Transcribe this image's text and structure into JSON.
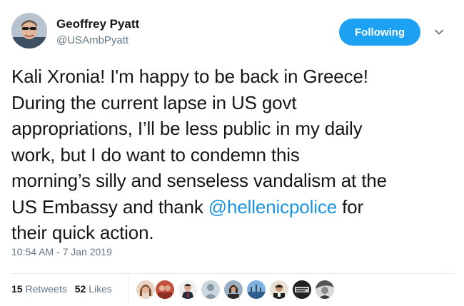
{
  "user": {
    "name": "Geoffrey Pyatt",
    "handle": "@USAmbPyatt"
  },
  "follow_button": {
    "label": "Following"
  },
  "tweet": {
    "lines": [
      {
        "text": "Kali Xronia! I'm happy to be back in Greece!"
      },
      {
        "text": "During the current lapse in US govt"
      },
      {
        "text": "appropriations, I’ll be less public in my daily"
      },
      {
        "text": "work, but I do want to condemn this"
      },
      {
        "text": "morning’s silly and senseless vandalism at the"
      },
      {
        "before": "US Embassy and thank ",
        "mention": "@hellenicpolice",
        "after": " for"
      },
      {
        "text": "their quick action."
      }
    ],
    "timestamp": "10:54 AM - 7 Jan 2019"
  },
  "stats": {
    "retweets_count": "15",
    "retweets_label": "Retweets",
    "likes_count": "52",
    "likes_label": "Likes"
  },
  "colors": {
    "accent": "#1da1f2",
    "mention": "#1b95e0",
    "secondary_text": "#657786"
  }
}
